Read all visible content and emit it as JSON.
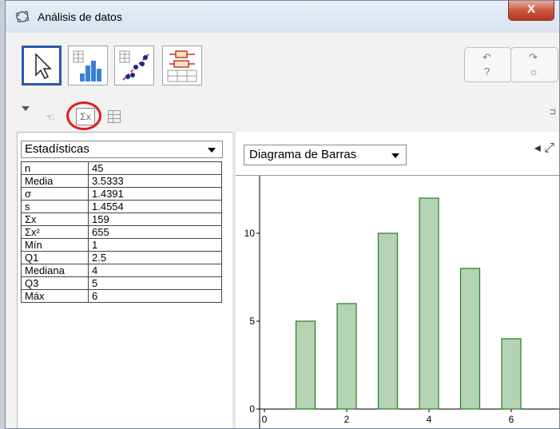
{
  "window": {
    "title": "Análisis de datos",
    "close_label": "X"
  },
  "toolbar": {
    "tools": [
      {
        "name": "move-tool"
      },
      {
        "name": "one-variable-analysis-tool"
      },
      {
        "name": "two-variable-regression-tool"
      },
      {
        "name": "multi-variable-analysis-tool"
      }
    ],
    "undo_glyph": "↶",
    "redo_glyph": "↷",
    "help_glyph": "?",
    "settings_glyph": "☼"
  },
  "subbar": {
    "hand_glyph": "☜",
    "sum_label": "Σx",
    "dock_glyph": "⊐"
  },
  "stats_panel": {
    "selector": "Estadísticas",
    "rows": [
      {
        "label": "n",
        "value": "45"
      },
      {
        "label": "Media",
        "value": "3.5333"
      },
      {
        "label": "σ",
        "value": "1.4391"
      },
      {
        "label": "s",
        "value": "1.4554"
      },
      {
        "label": "Σx",
        "value": "159"
      },
      {
        "label": "Σx²",
        "value": "655"
      },
      {
        "label": "Mín",
        "value": "1"
      },
      {
        "label": "Q1",
        "value": "2.5"
      },
      {
        "label": "Mediana",
        "value": "4"
      },
      {
        "label": "Q3",
        "value": "5"
      },
      {
        "label": "Máx",
        "value": "6"
      }
    ]
  },
  "chart_panel": {
    "selector": "Diagrama de Barras",
    "corner_glyphs": "◂ ⤢"
  },
  "colors": {
    "bar_fill": "#b3d3b3",
    "bar_stroke": "#2a7a2a",
    "highlight_ring": "#e01b1b"
  },
  "chart_data": {
    "type": "bar",
    "x": [
      1,
      2,
      3,
      4,
      5,
      6
    ],
    "values": [
      5,
      6,
      10,
      12,
      8,
      4
    ],
    "x_ticks": [
      0,
      2,
      4,
      6
    ],
    "y_ticks": [
      0,
      5,
      10
    ],
    "xlim": [
      0,
      6.7
    ],
    "ylim": [
      -0.5,
      13.3
    ],
    "grid": false,
    "title": "",
    "xlabel": "",
    "ylabel": ""
  }
}
